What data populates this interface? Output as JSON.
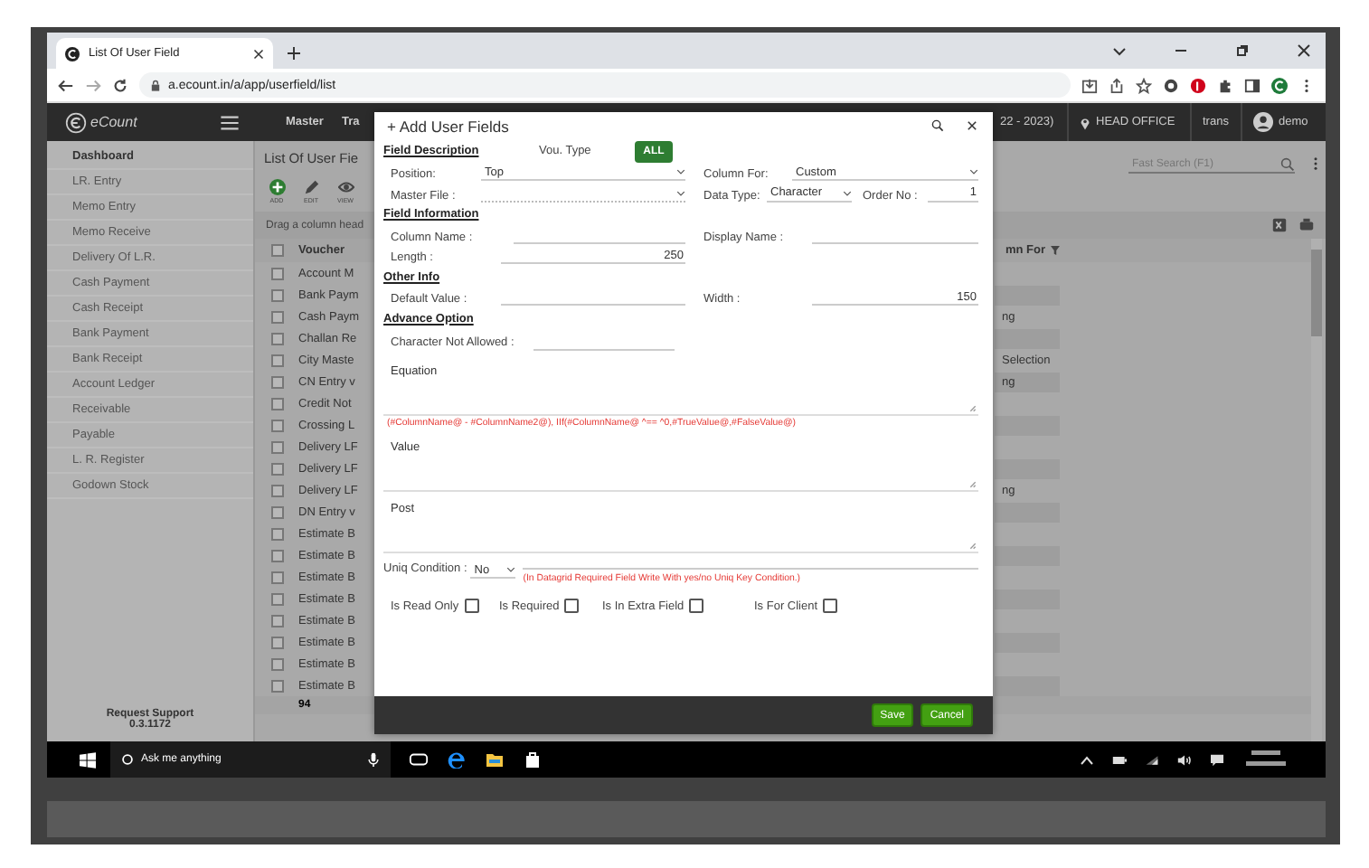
{
  "browser": {
    "tab_title": "List Of User Field",
    "url": "a.ecount.in/a/app/userfield/list"
  },
  "nav": {
    "logo": "eCount",
    "menu": [
      "Master",
      "Tra"
    ],
    "fiscal_year": "22 - 2023)",
    "branch": "HEAD OFFICE",
    "module": "trans",
    "user": "demo"
  },
  "sidebar": {
    "items": [
      {
        "label": "Dashboard",
        "selected": true
      },
      {
        "label": "LR. Entry",
        "selected": false
      },
      {
        "label": "Memo Entry",
        "selected": false
      },
      {
        "label": "Memo Receive",
        "selected": false
      },
      {
        "label": "Delivery Of L.R.",
        "selected": false
      },
      {
        "label": "Cash Payment",
        "selected": false
      },
      {
        "label": "Cash Receipt",
        "selected": false
      },
      {
        "label": "Bank Payment",
        "selected": false
      },
      {
        "label": "Bank Receipt",
        "selected": false
      },
      {
        "label": "Account Ledger",
        "selected": false
      },
      {
        "label": "Receivable",
        "selected": false
      },
      {
        "label": "Payable",
        "selected": false
      },
      {
        "label": "L. R. Register",
        "selected": false
      },
      {
        "label": "Godown Stock",
        "selected": false
      }
    ],
    "support": "Request Support",
    "version": "0.3.1172"
  },
  "list": {
    "title": "List Of User Fie",
    "toolbar": [
      "ADD",
      "EDIT",
      "VIEW"
    ],
    "group_hint": "Drag a column head",
    "search_placeholder": "Fast Search (F1)",
    "header_checked": false,
    "columns": [
      "Voucher",
      "mn For"
    ],
    "rows": [
      {
        "voucher": "Account M",
        "checked": false
      },
      {
        "voucher": "Bank Paym",
        "checked": false
      },
      {
        "voucher": "Cash Paym",
        "column_for": "ng",
        "checked": false
      },
      {
        "voucher": "Challan Re",
        "checked": false
      },
      {
        "voucher": "City Maste",
        "column_for": "Selection",
        "checked": false
      },
      {
        "voucher": "CN Entry v",
        "column_for": "ng",
        "checked": false
      },
      {
        "voucher": "Credit Not",
        "checked": false
      },
      {
        "voucher": "Crossing L",
        "checked": false
      },
      {
        "voucher": "Delivery LF",
        "checked": false
      },
      {
        "voucher": "Delivery LF",
        "checked": false
      },
      {
        "voucher": "Delivery LF",
        "column_for": "ng",
        "checked": false
      },
      {
        "voucher": "DN Entry v",
        "checked": false
      },
      {
        "voucher": "Estimate B",
        "checked": false
      },
      {
        "voucher": "Estimate B",
        "checked": false
      },
      {
        "voucher": "Estimate B",
        "checked": false
      },
      {
        "voucher": "Estimate B",
        "checked": false
      },
      {
        "voucher": "Estimate B",
        "checked": false
      },
      {
        "voucher": "Estimate B",
        "checked": false
      },
      {
        "voucher": "Estimate B",
        "checked": false
      },
      {
        "voucher": "Estimate B",
        "checked": false
      }
    ],
    "count": "94"
  },
  "dialog": {
    "title": "+ Add User Fields",
    "field_description": {
      "heading": "Field Description",
      "voucher_type_label": "Vou. Type",
      "voucher_type_button": "ALL",
      "position": {
        "label": "Position:",
        "value": "Top"
      },
      "column_for": {
        "label": "Column For:",
        "value": "Custom"
      },
      "master_file": {
        "label": "Master File :"
      },
      "data_type": {
        "label": "Data Type:",
        "value": "Character"
      },
      "order_no": {
        "label": "Order No :",
        "value": "1"
      }
    },
    "field_information": {
      "heading": "Field Information",
      "column_name": {
        "label": "Column Name :"
      },
      "display_name": {
        "label": "Display Name :"
      },
      "length": {
        "label": "Length :",
        "value": "250"
      }
    },
    "other_info": {
      "heading": "Other Info",
      "default_value": {
        "label": "Default Value :"
      },
      "width": {
        "label": "Width :",
        "value": "150"
      }
    },
    "advance_option": {
      "heading": "Advance Option",
      "character_not_allowed": {
        "label": "Character Not Allowed :"
      },
      "equation": {
        "label": "Equation",
        "hint": "(#ColumnName@ - #ColumnName2@), IIf(#ColumnName@ ^== ^0,#TrueValue@,#FalseValue@)"
      },
      "value": {
        "label": "Value"
      },
      "post": {
        "label": "Post"
      },
      "uniq_condition": {
        "label": "Uniq Condition :",
        "value": "No",
        "hint": "(In Datagrid Required Field Write With yes/no Uniq Key Condition.)"
      }
    },
    "checkboxes": [
      {
        "label": "Is Read Only",
        "checked": false
      },
      {
        "label": "Is Required",
        "checked": false
      },
      {
        "label": "Is In Extra Field",
        "checked": false
      },
      {
        "label": "Is For Client",
        "checked": false
      }
    ],
    "buttons": [
      "Save",
      "Cancel"
    ]
  },
  "taskbar": {
    "search_placeholder": "Ask me anything"
  }
}
